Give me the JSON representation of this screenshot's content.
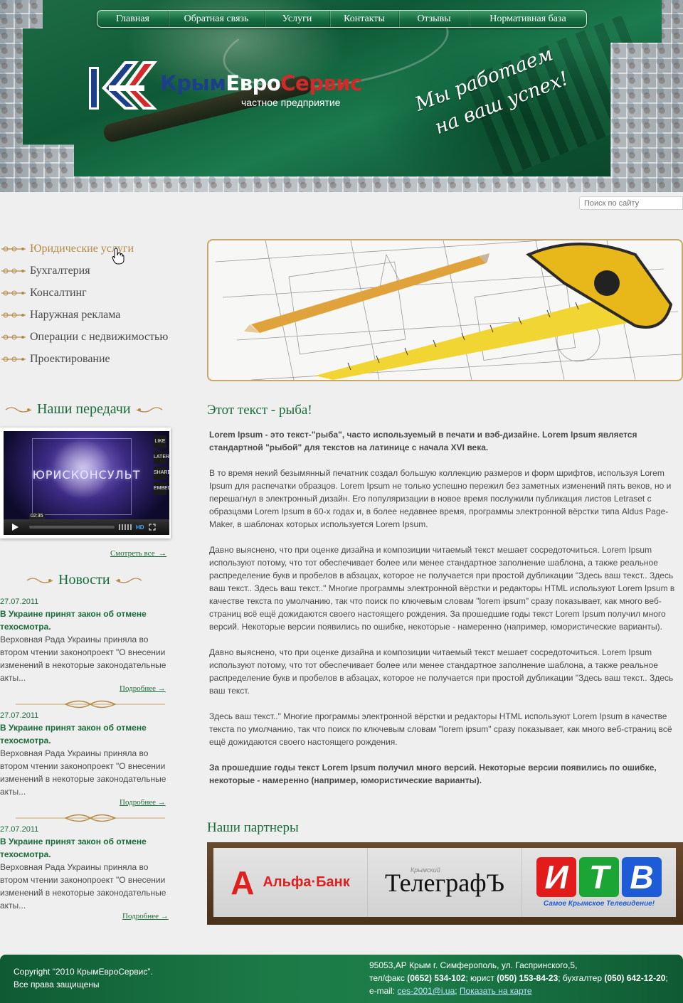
{
  "nav": [
    "Главная",
    "Обратная связь",
    "Услуги",
    "Контакты",
    "Отзывы",
    "Нормативная база"
  ],
  "logo": {
    "brand_1": "Крым",
    "brand_2": "Евро",
    "brand_3": "Сервис",
    "sub": "частное предприятие"
  },
  "slogan": {
    "line1": "Мы работаем",
    "line2": "на ваш успех!"
  },
  "search": {
    "placeholder": "Поиск по сайту"
  },
  "services": [
    "Юридические услуги",
    "Бухгалтерия",
    "Консалтинг",
    "Наружная реклама",
    "Операции с недвижимостью",
    "Проектирование"
  ],
  "video_section": {
    "title": "Наши передачи",
    "video_title": "ЮРИСКОНСУЛЬТ",
    "time": "02:35",
    "side_buttons": [
      "LIKE",
      "LATER",
      "SHARE",
      "EMBED"
    ],
    "hd": "HD",
    "more": "Смотреть все"
  },
  "news_section": {
    "title": "Новости",
    "items": [
      {
        "date": "27.07.2011",
        "title": "В Украине принят закон об отмене техосмотра.",
        "body": "Верховная Рада Украины приняла во втором чтении законопроект \"О внесении изменений в некоторые законодательные акты...",
        "more": "Подробнее"
      },
      {
        "date": "27.07.2011",
        "title": "В Украине принят закон об отмене техосмотра.",
        "body": "Верховная Рада Украины приняла во втором чтении законопроект \"О внесении изменений в некоторые законодательные акты...",
        "more": "Подробнее"
      },
      {
        "date": "27.07.2011",
        "title": "В Украине принят закон об отмене техосмотра.",
        "body": "Верховная Рада Украины приняла во втором чтении законопроект \"О внесении изменений в некоторые законодательные акты...",
        "more": "Подробнее"
      }
    ]
  },
  "main": {
    "title": "Этот текст - рыба!",
    "paragraphs": [
      "Lorem Ipsum - это текст-\"рыба\", часто используемый в печати и вэб-дизайне. Lorem Ipsum является стандартной \"рыбой\" для текстов на латинице с начала XVI века.",
      "В то время некий безымянный печатник создал большую коллекцию размеров и форм шрифтов, используя Lorem Ipsum для распечатки образцов. Lorem Ipsum не только успешно пережил без заметных изменений пять веков, но и перешагнул в электронный дизайн. Его популяризации в новое время послужили публикация листов Letraset с образцами Lorem Ipsum в 60-х годах и, в более недавнее время, программы электронной вёрстки типа Aldus Page-Maker, в шаблонах которых используется Lorem Ipsum.",
      "Давно выяснено, что при оценке дизайна и композиции читаемый текст мешает сосредоточиться. Lorem Ipsum используют потому, что тот обеспечивает более или менее стандартное заполнение шаблона, а также реальное распределение букв и пробелов в абзацах, которое не получается при простой дубликации \"Здесь ваш текст.. Здесь ваш текст.. Здесь ваш текст..\" Многие программы электронной вёрстки и редакторы HTML используют Lorem Ipsum в качестве текста по умолчанию, так что поиск по ключевым словам \"lorem ipsum\" сразу показывает, как много веб-страниц всё ещё дожидаются своего настоящего рождения. За прошедшие годы текст Lorem Ipsum получил много версий. Некоторые версии появились по ошибке, некоторые - намеренно (например, юмористические варианты).",
      "Давно выяснено, что при оценке дизайна и композиции читаемый текст мешает сосредоточиться. Lorem Ipsum используют потому, что тот обеспечивает более или менее стандартное заполнение шаблона, а также реальное распределение букв и пробелов в абзацах, которое не получается при простой дубликации \"Здесь ваш текст.. Здесь ваш текст.",
      "Здесь ваш текст..\" Многие программы электронной вёрстки и редакторы HTML используют Lorem Ipsum в качестве текста по умолчанию, так что поиск по ключевым словам \"lorem ipsum\" сразу показывает, как много веб-страниц всё ещё дожидаются своего настоящего рождения.",
      "За прошедшие годы текст Lorem Ipsum получил много версий. Некоторые версии появились по ошибке, некоторые - намеренно (например, юмористические варианты)."
    ]
  },
  "partners": {
    "title": "Наши партнеры",
    "alfa": {
      "letter": "А",
      "name": "Альфа·Банк"
    },
    "telegraf": {
      "small": "Крымский",
      "name": "ТелеграфЪ"
    },
    "itv": {
      "letters": [
        "И",
        "Т",
        "В"
      ],
      "tagline": "Самое Крымское Телевидение!"
    }
  },
  "footer": {
    "copy1": "Copyright \"2010 КрымЕвроСервис\".",
    "copy2": "Все права защищены",
    "address": "95053,АР Крым г. Симферополь, ул. Гаспринского,5,",
    "phones_prefix": "тел/факс ",
    "phone1": "(0652) 534-102",
    "phones_mid1": "; юрист ",
    "phone2": "(050) 153-84-23",
    "phones_mid2": "; бухгалтер ",
    "phone3": "(050) 642-12-20",
    "phones_end": ";",
    "email_label": "e-mail: ",
    "email": "ces-2001@i.ua",
    "sep": "; ",
    "map_link": "Показать на карте"
  }
}
